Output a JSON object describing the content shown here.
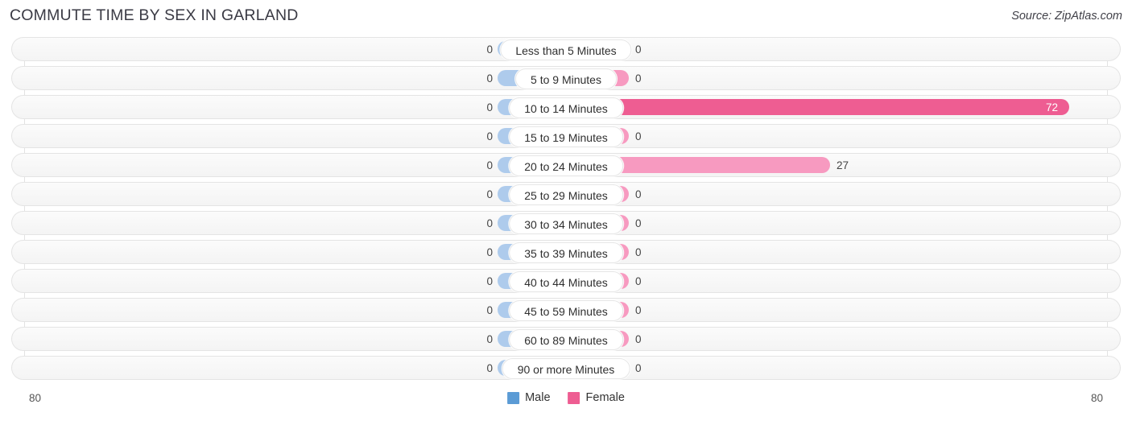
{
  "header": {
    "title": "COMMUTE TIME BY SEX IN GARLAND",
    "source": "Source: ZipAtlas.com"
  },
  "legend": {
    "male_label": "Male",
    "female_label": "Female",
    "male_color": "#5b9bd5",
    "female_color": "#ee5d92"
  },
  "axis": {
    "left_label": "80",
    "right_label": "80",
    "max": 80
  },
  "chart_data": {
    "type": "bar",
    "orientation": "horizontal-diverging",
    "title": "COMMUTE TIME BY SEX IN GARLAND",
    "xlabel": "",
    "ylabel": "",
    "xlim": [
      80,
      80
    ],
    "grid": true,
    "legend_position": "bottom-center",
    "categories": [
      "Less than 5 Minutes",
      "5 to 9 Minutes",
      "10 to 14 Minutes",
      "15 to 19 Minutes",
      "20 to 24 Minutes",
      "25 to 29 Minutes",
      "30 to 34 Minutes",
      "35 to 39 Minutes",
      "40 to 44 Minutes",
      "45 to 59 Minutes",
      "60 to 89 Minutes",
      "90 or more Minutes"
    ],
    "series": [
      {
        "name": "Male",
        "values": [
          0,
          0,
          0,
          0,
          0,
          0,
          0,
          0,
          0,
          0,
          0,
          0
        ]
      },
      {
        "name": "Female",
        "values": [
          0,
          0,
          72,
          0,
          27,
          0,
          0,
          0,
          0,
          0,
          0,
          0
        ]
      }
    ]
  },
  "rows": [
    {
      "label": "Less than 5 Minutes",
      "male": "0",
      "female": "0",
      "male_w": 85,
      "female_w": 78,
      "female_strong": false,
      "female_inside": false
    },
    {
      "label": "5 to 9 Minutes",
      "male": "0",
      "female": "0",
      "male_w": 85,
      "female_w": 78,
      "female_strong": false,
      "female_inside": false
    },
    {
      "label": "10 to 14 Minutes",
      "male": "0",
      "female": "72",
      "male_w": 85,
      "female_w": 625,
      "female_strong": true,
      "female_inside": true
    },
    {
      "label": "15 to 19 Minutes",
      "male": "0",
      "female": "0",
      "male_w": 85,
      "female_w": 78,
      "female_strong": false,
      "female_inside": false
    },
    {
      "label": "20 to 24 Minutes",
      "male": "0",
      "female": "27",
      "male_w": 85,
      "female_w": 328,
      "female_strong": false,
      "female_inside": false
    },
    {
      "label": "25 to 29 Minutes",
      "male": "0",
      "female": "0",
      "male_w": 85,
      "female_w": 78,
      "female_strong": false,
      "female_inside": false
    },
    {
      "label": "30 to 34 Minutes",
      "male": "0",
      "female": "0",
      "male_w": 85,
      "female_w": 78,
      "female_strong": false,
      "female_inside": false
    },
    {
      "label": "35 to 39 Minutes",
      "male": "0",
      "female": "0",
      "male_w": 85,
      "female_w": 78,
      "female_strong": false,
      "female_inside": false
    },
    {
      "label": "40 to 44 Minutes",
      "male": "0",
      "female": "0",
      "male_w": 85,
      "female_w": 78,
      "female_strong": false,
      "female_inside": false
    },
    {
      "label": "45 to 59 Minutes",
      "male": "0",
      "female": "0",
      "male_w": 85,
      "female_w": 78,
      "female_strong": false,
      "female_inside": false
    },
    {
      "label": "60 to 89 Minutes",
      "male": "0",
      "female": "0",
      "male_w": 85,
      "female_w": 78,
      "female_strong": false,
      "female_inside": false
    },
    {
      "label": "90 or more Minutes",
      "male": "0",
      "female": "0",
      "male_w": 85,
      "female_w": 78,
      "female_strong": false,
      "female_inside": false
    }
  ]
}
